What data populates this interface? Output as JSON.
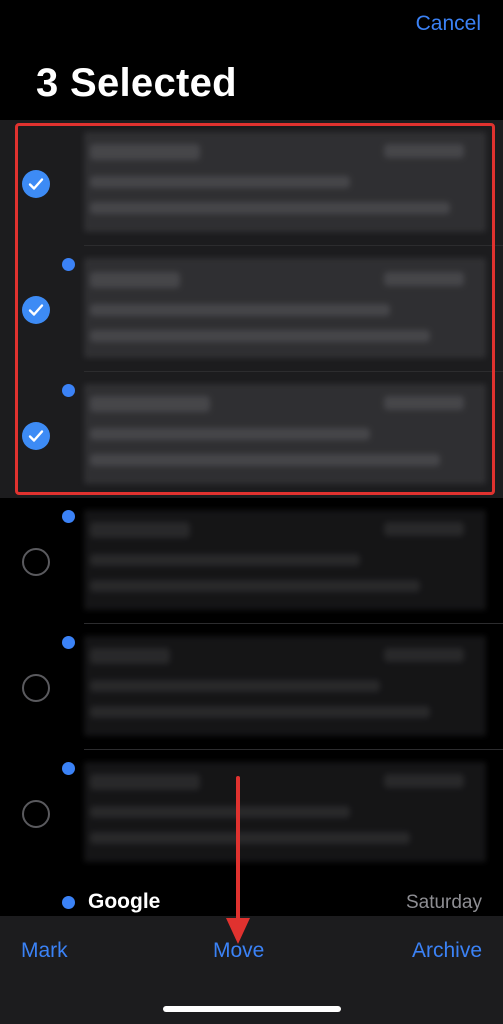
{
  "header": {
    "cancel_label": "Cancel",
    "title": "3 Selected"
  },
  "mail_list": {
    "rows": [
      {
        "selected": true,
        "unread": false
      },
      {
        "selected": true,
        "unread": true
      },
      {
        "selected": true,
        "unread": true
      },
      {
        "selected": false,
        "unread": true
      },
      {
        "selected": false,
        "unread": true
      },
      {
        "selected": false,
        "unread": true
      }
    ],
    "last_row": {
      "sender": "Google",
      "date": "Saturday",
      "unread": true
    }
  },
  "toolbar": {
    "mark_label": "Mark",
    "move_label": "Move",
    "archive_label": "Archive"
  },
  "colors": {
    "accent": "#3b82f6",
    "check_fill": "#3d8bf5",
    "annotation_red": "#e0322f",
    "background": "#000000",
    "selected_row_bg": "#1c1c1e"
  },
  "icons": {
    "selected_marker": "checkmark-circle-icon",
    "unselected_marker": "empty-circle-icon",
    "unread_marker": "unread-dot-icon"
  }
}
